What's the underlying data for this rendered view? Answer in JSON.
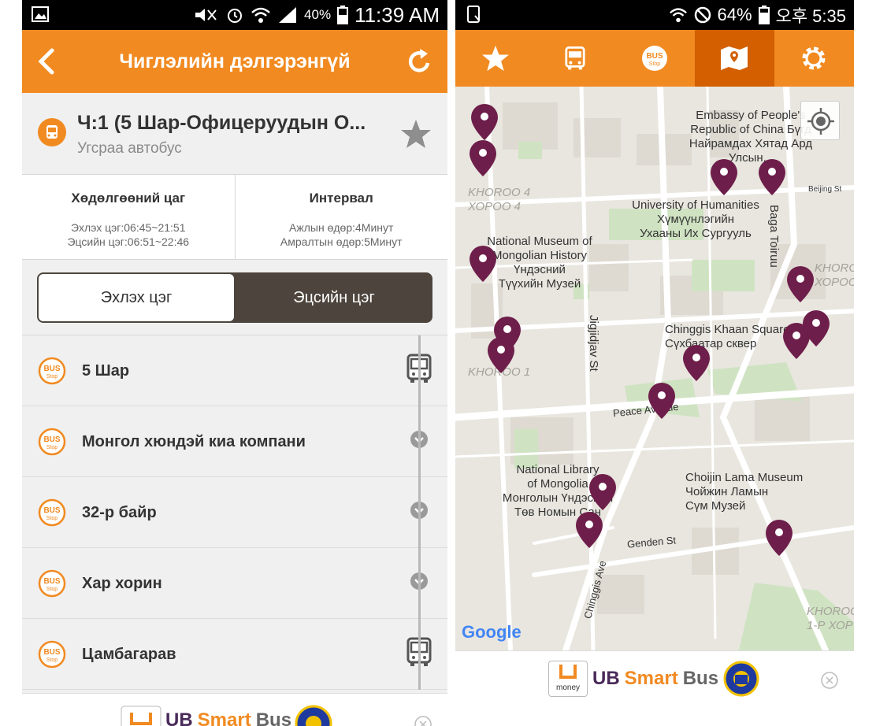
{
  "left": {
    "status": {
      "battery": "40%",
      "time": "11:39 AM"
    },
    "header": {
      "title": "Чиглэлийн дэлгэрэнгүй"
    },
    "route": {
      "name": "Ч:1 (5 Шар-Офицеруудын О...",
      "type": "Угсраа автобус"
    },
    "info": {
      "schedule_title": "Хөдөлгөөний цаг",
      "start_time": "Эхлэх цэг:06:45~21:51",
      "end_time": "Эцсийн цэг:06:51~22:46",
      "interval_title": "Интервал",
      "weekday": "Ажлын өдөр:4Минут",
      "weekend": "Амралтын өдөр:5Минут"
    },
    "segment": {
      "start_label": "Эхлэх цэг",
      "end_label": "Эцсийн цэг",
      "selected": "Эхлэх цэг"
    },
    "stops": [
      {
        "name": "5 Шар",
        "marker": "bus-icon"
      },
      {
        "name": "Монгол хюндэй киа компани",
        "marker": "chevron-down-icon"
      },
      {
        "name": "32-р байр",
        "marker": "chevron-down-icon"
      },
      {
        "name": "Хар хорин",
        "marker": "chevron-down-icon"
      },
      {
        "name": "Цамбагарав",
        "marker": "bus-icon"
      }
    ],
    "ad": {
      "ub": "UB",
      "smart": "Smart",
      "bus": "Bus"
    }
  },
  "right": {
    "status": {
      "battery": "64%",
      "time": "오후 5:35"
    },
    "tabs": [
      "star-icon",
      "bus-icon",
      "bus-stop-icon",
      "map-icon",
      "gear-icon"
    ],
    "active_tab": "map-icon",
    "map": {
      "labels": {
        "embassy": "Embassy of People's Republic of China Бүгд Найрамдах Хятад Ард Улсын...",
        "beijing": "Beijing St",
        "baga_toiruu": "Baga Toiruu",
        "khoroo4": "KHOROO 4\nХОРОО 4",
        "humanities": "University of Humanities\nХүмүүнлэгийн\nУхааны Их Сургууль",
        "museum": "National Museum of\nMongolian History\nҮндэсний\nТүүхийн Музей",
        "jigjidjav": "Jigjidjav St",
        "chinggis_sq": "Chinggis Khaan Square\nСүхбаатар сквер",
        "khoroo_r": "KHOROO\nХОРОО",
        "khoroo1": "KHOROO 1",
        "peace": "Peace Avenue",
        "library": "National Library\nof Mongolia\nМонголын Үндэсний\nТөв Номын Сан",
        "choijin": "Choijin Lama Museum\nЧойжин Ламын\nСүм Музей",
        "genden": "Genden St",
        "chinggis_ave": "Chinggis Ave",
        "khoroo_br": "KHOROO\n1-Р ХОР",
        "google": "Google"
      }
    },
    "ad": {
      "money": "money",
      "ub": "UB",
      "smart": "Smart",
      "bus": "Bus"
    }
  },
  "colors": {
    "orange": "#f18a21",
    "active_tab": "#d35f00",
    "pin": "#6e1e4a",
    "segment_dark": "#4d453d"
  }
}
